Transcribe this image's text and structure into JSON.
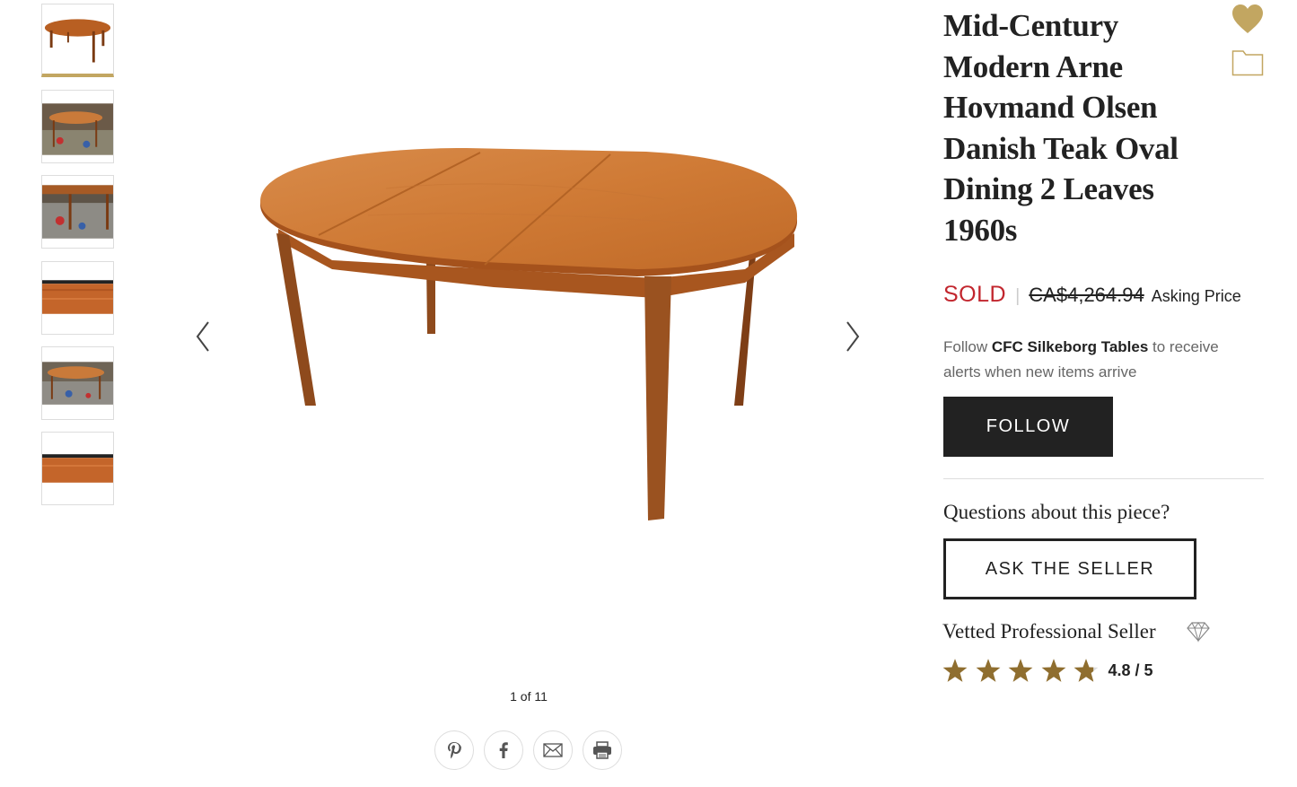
{
  "gallery": {
    "counter": "1 of 11",
    "prev_icon": "chevron-left-icon",
    "next_icon": "chevron-right-icon",
    "thumbnails": [
      {
        "name": "thumbnail-1",
        "active": true
      },
      {
        "name": "thumbnail-2",
        "active": false
      },
      {
        "name": "thumbnail-3",
        "active": false
      },
      {
        "name": "thumbnail-4",
        "active": false
      },
      {
        "name": "thumbnail-5",
        "active": false
      },
      {
        "name": "thumbnail-6",
        "active": false
      }
    ],
    "share_icons": [
      "pinterest-icon",
      "facebook-icon",
      "email-icon",
      "print-icon"
    ]
  },
  "product": {
    "title": "Mid-Century Modern Arne Hovmand Olsen Danish Teak Oval Dining 2 Leaves 1960s",
    "status": "SOLD",
    "price": "CA$4,264.94",
    "price_label": "Asking Price"
  },
  "follow": {
    "prefix": "Follow ",
    "seller": "CFC Silkeborg Tables",
    "suffix": " to receive alerts when new items arrive",
    "button": "FOLLOW"
  },
  "questions": {
    "heading": "Questions about this piece?",
    "button": "ASK THE SELLER"
  },
  "seller": {
    "badge": "Vetted Professional Seller",
    "rating": "4.8 / 5",
    "stars": 4.8
  },
  "colors": {
    "accent_gold": "#c2a661",
    "star_gold": "#8f6e2f",
    "sold_red": "#c2262e",
    "dark": "#222222"
  }
}
